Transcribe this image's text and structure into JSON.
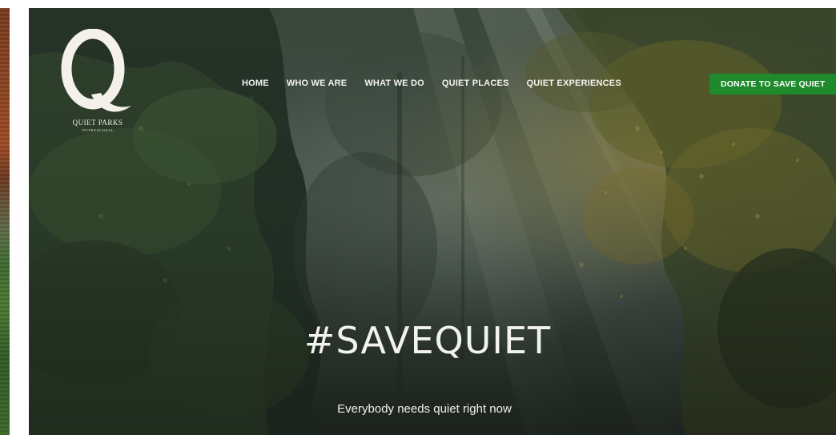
{
  "logo": {
    "name": "QUIET PARKS",
    "subline": "INTERNATIONAL",
    "letter": "Q"
  },
  "nav": {
    "items": [
      {
        "label": "HOME"
      },
      {
        "label": "WHO WE ARE"
      },
      {
        "label": "WHAT WE DO"
      },
      {
        "label": "QUIET PLACES"
      },
      {
        "label": "QUIET EXPERIENCES"
      }
    ],
    "donate_label": "DONATE TO SAVE QUIET"
  },
  "hero": {
    "headline": "#SAVEQUIET",
    "tagline": "Everybody needs quiet right now"
  },
  "colors": {
    "donate_button": "#1f8a2b",
    "hero_text": "#f2f2ee",
    "forest_dark": "#2e3a30"
  }
}
